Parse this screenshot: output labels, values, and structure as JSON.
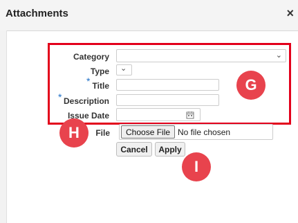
{
  "dialog": {
    "title": "Attachments",
    "close_glyph": "×"
  },
  "form": {
    "category_label": "Category",
    "type_label": "Type",
    "title_label": "Title",
    "description_label": "Description",
    "issue_date_label": "Issue Date",
    "file_label": "File",
    "required_marker": "*",
    "choose_file_label": "Choose File",
    "no_file_text": "No file chosen",
    "cancel_label": "Cancel",
    "apply_label": "Apply"
  },
  "annotations": {
    "g": "G",
    "h": "H",
    "i": "I"
  },
  "icons": {
    "chevron": "chevron-down-icon",
    "calendar": "calendar-icon"
  },
  "colors": {
    "highlight": "#e3001b",
    "badge": "#e8434d",
    "required": "#1e6fc7"
  }
}
